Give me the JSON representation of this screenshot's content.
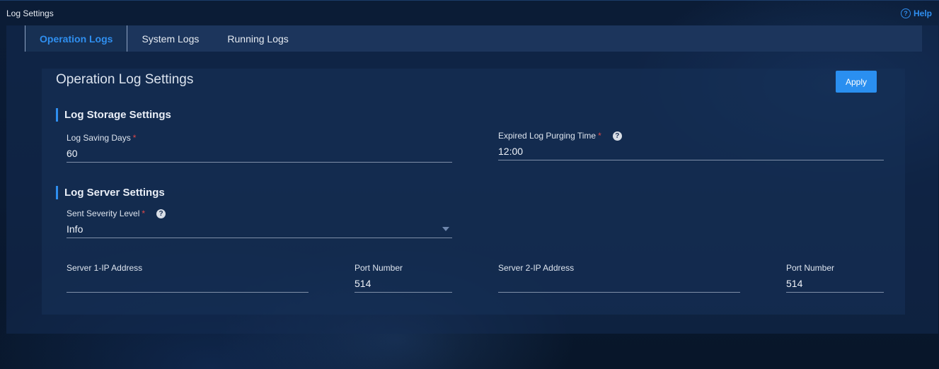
{
  "window": {
    "title": "Log Settings",
    "help_label": "Help",
    "help_icon": "question-circle-icon"
  },
  "tabs": [
    {
      "label": "Operation Logs",
      "active": true
    },
    {
      "label": "System Logs",
      "active": false
    },
    {
      "label": "Running Logs",
      "active": false
    }
  ],
  "card": {
    "title": "Operation Log Settings",
    "apply_label": "Apply"
  },
  "storage": {
    "heading": "Log Storage Settings",
    "saving_days": {
      "label": "Log Saving Days",
      "required": "*",
      "value": "60"
    },
    "purge_time": {
      "label": "Expired Log Purging Time",
      "required": "*",
      "value": "12:00",
      "help": "?"
    }
  },
  "server": {
    "heading": "Log Server Settings",
    "severity": {
      "label": "Sent Severity Level",
      "required": "*",
      "value": "Info",
      "help": "?"
    },
    "server1_ip": {
      "label": "Server 1-IP Address",
      "value": ""
    },
    "port1": {
      "label": "Port Number",
      "value": "514"
    },
    "server2_ip": {
      "label": "Server 2-IP Address",
      "value": ""
    },
    "port2": {
      "label": "Port Number",
      "value": "514"
    }
  },
  "colors": {
    "accent": "#2f8ff0",
    "required": "#e04848",
    "background": "#0b1c36"
  }
}
